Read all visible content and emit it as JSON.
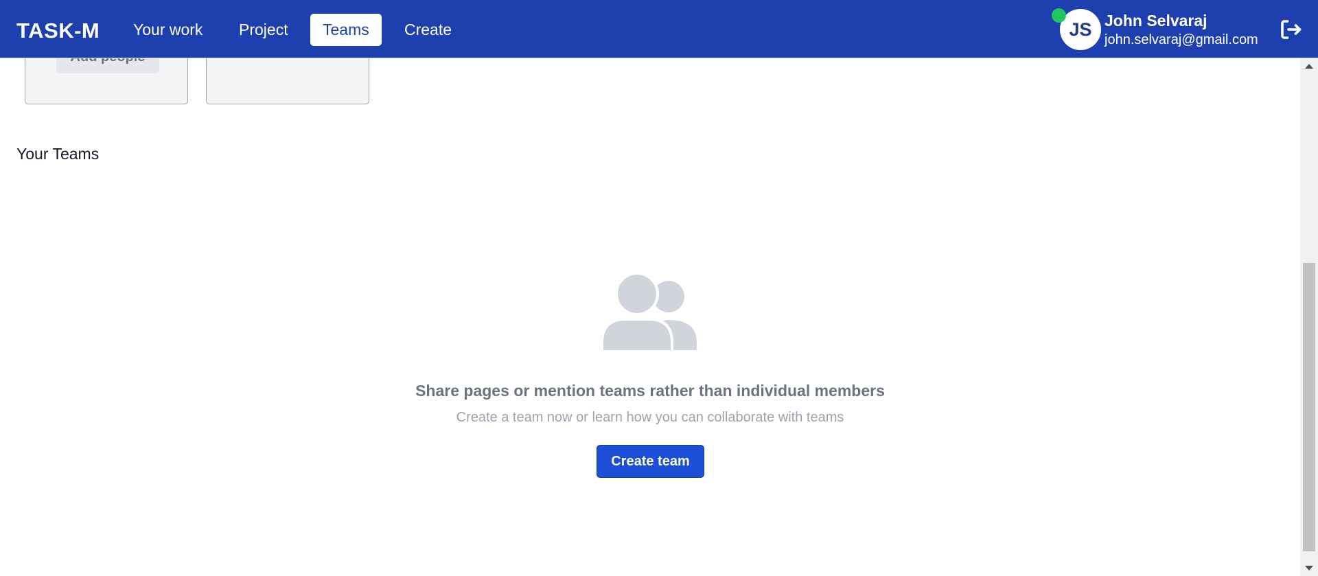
{
  "header": {
    "logo": "TASK-M",
    "nav": [
      {
        "label": "Your work",
        "active": false
      },
      {
        "label": "Project",
        "active": false
      },
      {
        "label": "Teams",
        "active": true
      },
      {
        "label": "Create",
        "active": false
      }
    ],
    "user": {
      "initials": "JS",
      "name": "John Selvaraj",
      "email": "john.selvaraj@gmail.com",
      "online": true
    },
    "logout_icon": "logout-icon"
  },
  "cards": [
    {
      "button_label": "Add people"
    },
    {
      "button_label": ""
    }
  ],
  "teams_section": {
    "title": "Your Teams",
    "empty_icon": "people-group-icon",
    "empty_heading": "Share pages or mention teams rather than individual members",
    "empty_subtext": "Create a team now or learn how you can collaborate with teams",
    "create_button": "Create team"
  },
  "colors": {
    "brand": "#1e40af",
    "primary_button": "#1d4ed8",
    "online": "#22c55e",
    "muted_text": "#6b7280",
    "icon_gray": "#d1d5db"
  }
}
